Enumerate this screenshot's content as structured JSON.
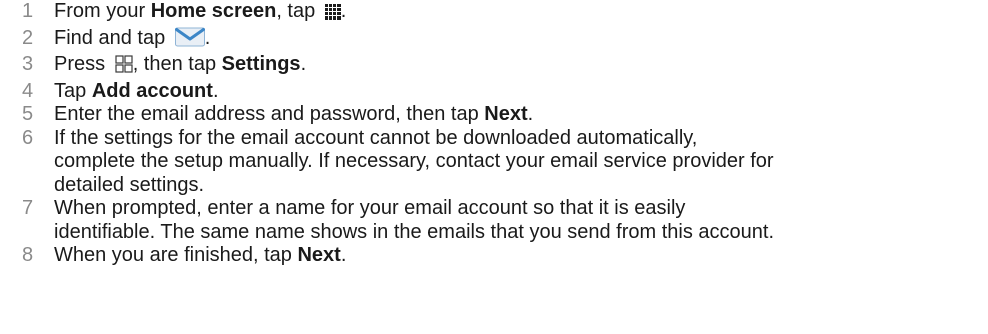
{
  "steps": [
    {
      "num": "1",
      "pre": "From your ",
      "bold1": "Home screen",
      "mid": ", tap ",
      "icon": "app-grid-icon",
      "post": "."
    },
    {
      "num": "2",
      "pre": "Find and tap ",
      "icon": "email-envelope-icon",
      "post": "."
    },
    {
      "num": "3",
      "pre": "Press ",
      "icon": "menu-icon",
      "mid": ", then tap ",
      "bold1": "Settings",
      "post": "."
    },
    {
      "num": "4",
      "pre": "Tap ",
      "bold1": "Add account",
      "post": "."
    },
    {
      "num": "5",
      "pre": "Enter the email address and password, then tap ",
      "bold1": "Next",
      "post": "."
    },
    {
      "num": "6",
      "text": "If the settings for the email account cannot be downloaded automatically,\ncomplete the setup manually. If necessary, contact your email service provider for\ndetailed settings."
    },
    {
      "num": "7",
      "text": "When prompted, enter a name for your email account so that it is easily\nidentifiable. The same name shows in the emails that you send from this account."
    },
    {
      "num": "8",
      "pre": "When you are finished, tap ",
      "bold1": "Next",
      "post": "."
    }
  ]
}
